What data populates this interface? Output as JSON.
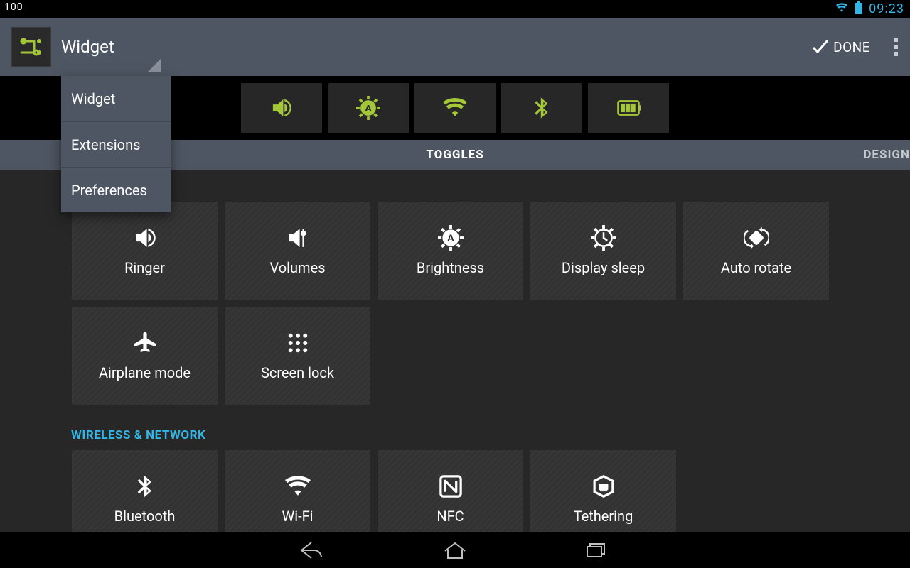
{
  "statusbar": {
    "battery_text": "100",
    "clock": "09:23"
  },
  "actionbar": {
    "title": "Widget",
    "done_label": "DONE"
  },
  "dropdown_items": [
    "Widget",
    "Extensions",
    "Preferences"
  ],
  "tabs": {
    "center": "TOGGLES",
    "right": "DESIGN"
  },
  "preview_tiles": [
    {
      "icon": "volume"
    },
    {
      "icon": "brightness-auto"
    },
    {
      "icon": "wifi"
    },
    {
      "icon": "bluetooth"
    },
    {
      "icon": "battery"
    }
  ],
  "groups": [
    {
      "title": null,
      "tiles": [
        {
          "label": "Ringer",
          "icon": "volume"
        },
        {
          "label": "Volumes",
          "icon": "sliders"
        },
        {
          "label": "Brightness",
          "icon": "brightness-auto"
        },
        {
          "label": "Display sleep",
          "icon": "sleep"
        },
        {
          "label": "Auto rotate",
          "icon": "rotate"
        },
        {
          "label": "Airplane mode",
          "icon": "airplane"
        },
        {
          "label": "Screen lock",
          "icon": "lock-dots"
        }
      ]
    },
    {
      "title": "WIRELESS & NETWORK",
      "tiles": [
        {
          "label": "Bluetooth",
          "icon": "bluetooth"
        },
        {
          "label": "Wi-Fi",
          "icon": "wifi"
        },
        {
          "label": "NFC",
          "icon": "nfc"
        },
        {
          "label": "Tethering",
          "icon": "tether"
        }
      ]
    }
  ]
}
